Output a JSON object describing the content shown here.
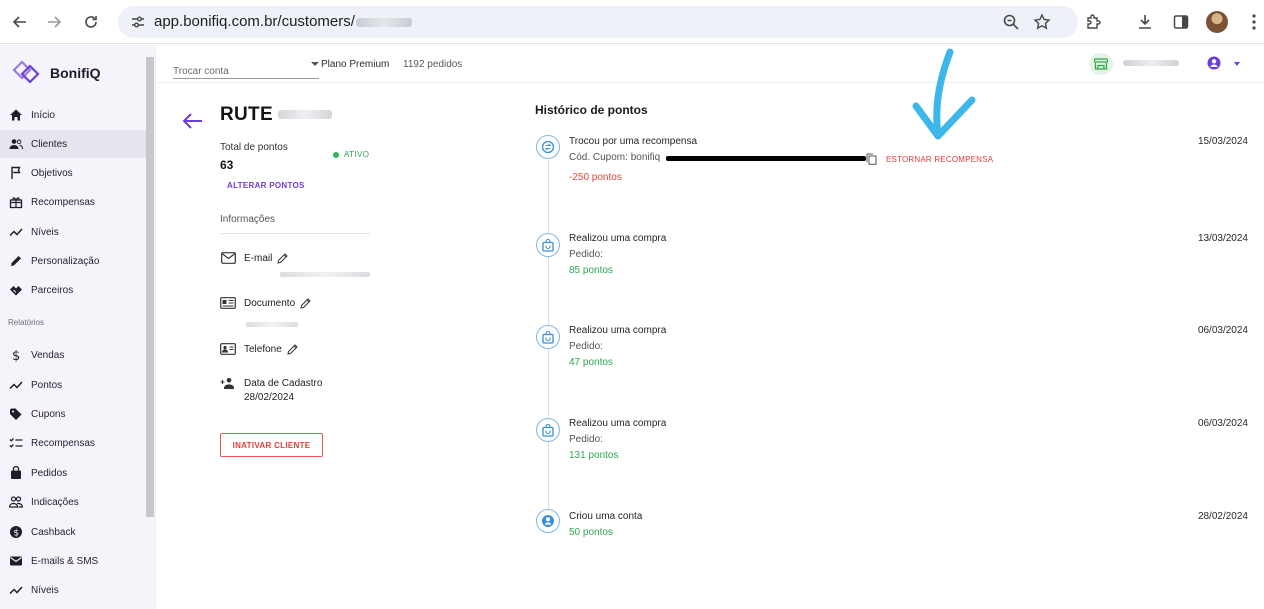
{
  "browser": {
    "url_prefix": "app.bonifiq.com.br/customers/"
  },
  "app": {
    "brand": "BonifiQ"
  },
  "sidebar": {
    "items": [
      {
        "label": "Início",
        "icon": "home-icon"
      },
      {
        "label": "Clientes",
        "icon": "users-icon",
        "active": true
      },
      {
        "label": "Objetivos",
        "icon": "flag-icon"
      },
      {
        "label": "Recompensas",
        "icon": "gift-icon"
      },
      {
        "label": "Níveis",
        "icon": "trend-icon"
      },
      {
        "label": "Personalização",
        "icon": "pencil-icon"
      },
      {
        "label": "Parceiros",
        "icon": "handshake-icon"
      }
    ],
    "section": "Relatórios",
    "report_items": [
      {
        "label": "Vendas",
        "icon": "dollar-icon"
      },
      {
        "label": "Pontos",
        "icon": "trend-icon"
      },
      {
        "label": "Cupons",
        "icon": "tag-icon"
      },
      {
        "label": "Recompensas",
        "icon": "checklist-icon"
      },
      {
        "label": "Pedidos",
        "icon": "bag-icon"
      },
      {
        "label": "Indicações",
        "icon": "group-icon"
      },
      {
        "label": "Cashback",
        "icon": "coin-icon"
      },
      {
        "label": "E-mails & SMS",
        "icon": "mail-icon"
      },
      {
        "label": "Níveis",
        "icon": "trend-icon"
      }
    ]
  },
  "topbar": {
    "account_placeholder": "Trocar conta",
    "plan": "Plano Premium",
    "orders": "1192 pedidos"
  },
  "customer": {
    "name": "RUTE",
    "total_points_label": "Total de pontos",
    "total_points": "63",
    "status": "ATIVO",
    "alter_points": "ALTERAR PONTOS",
    "info_heading": "Informações",
    "email_label": "E-mail",
    "document_label": "Documento",
    "phone_label": "Telefone",
    "registration_label": "Data de Cadastro",
    "registration_date": "28/02/2024",
    "deactivate": "INATIVAR CLIENTE"
  },
  "history": {
    "title": "Histórico de pontos",
    "events": [
      {
        "title": "Trocou por uma recompensa",
        "sub": "Cód. Cupom: bonifiq",
        "points": "-250 pontos",
        "date": "15/03/2024",
        "action": "ESTORNAR RECOMPENSA",
        "icon": "exchange-icon"
      },
      {
        "title": "Realizou uma compra",
        "sub": "Pedido:",
        "points": "85 pontos",
        "date": "13/03/2024",
        "icon": "shopping-bag-icon"
      },
      {
        "title": "Realizou uma compra",
        "sub": "Pedido:",
        "points": "47 pontos",
        "date": "06/03/2024",
        "icon": "shopping-bag-icon"
      },
      {
        "title": "Realizou uma compra",
        "sub": "Pedido:",
        "points": "131 pontos",
        "date": "06/03/2024",
        "icon": "shopping-bag-icon"
      },
      {
        "title": "Criou uma conta",
        "sub": "",
        "points": "50 pontos",
        "date": "28/02/2024",
        "icon": "account-icon"
      }
    ]
  },
  "colors": {
    "accent": "#6b3fd8",
    "success": "#2ea84f",
    "danger": "#e03c3c",
    "annotation": "#3db7e9"
  }
}
